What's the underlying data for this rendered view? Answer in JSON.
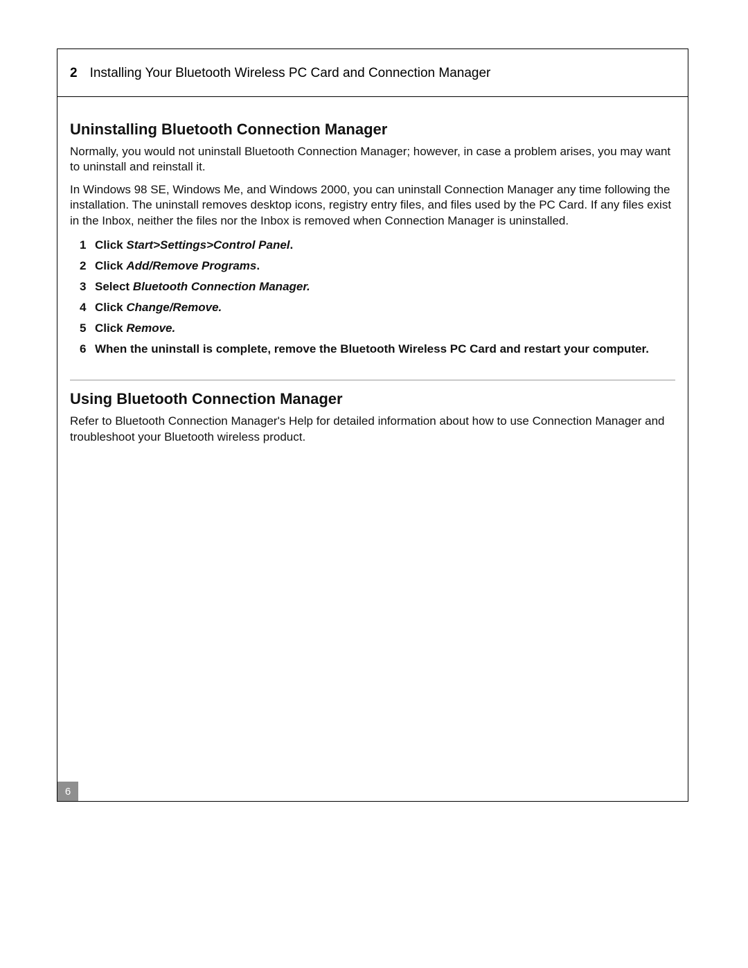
{
  "header": {
    "chapter_number": "2",
    "chapter_title": "Installing Your Bluetooth Wireless PC Card and Connection Manager"
  },
  "section1": {
    "heading": "Uninstalling Bluetooth Connection Manager",
    "para1": "Normally, you would not uninstall Bluetooth Connection Manager; however, in case a problem arises, you may want to uninstall and reinstall it.",
    "para2": "In Windows 98 SE, Windows Me, and Windows 2000, you can uninstall Connection Manager any time following the installation. The uninstall removes desktop icons, registry entry files, and files used by the PC Card. If any files exist in the Inbox, neither the files nor the Inbox is removed when Connection Manager is uninstalled.",
    "steps": [
      {
        "num": "1",
        "lead": "Click ",
        "cmd": "Start>Settings>Control Panel",
        "tail": "."
      },
      {
        "num": "2",
        "lead": "Click ",
        "cmd": "Add/Remove Programs",
        "tail": "."
      },
      {
        "num": "3",
        "lead": "Select ",
        "cmd": "Bluetooth Connection Manager.",
        "tail": ""
      },
      {
        "num": "4",
        "lead": "Click ",
        "cmd": "Change/Remove.",
        "tail": ""
      },
      {
        "num": "5",
        "lead": "Click ",
        "cmd": "Remove.",
        "tail": ""
      },
      {
        "num": "6",
        "lead": "When the uninstall is complete, remove the Bluetooth Wireless PC Card and restart your computer.",
        "cmd": "",
        "tail": ""
      }
    ]
  },
  "section2": {
    "heading": "Using Bluetooth Connection Manager",
    "para1": "Refer to Bluetooth Connection Manager's Help for detailed information about how to use Connection Manager and troubleshoot your Bluetooth wireless product."
  },
  "page_number": "6"
}
